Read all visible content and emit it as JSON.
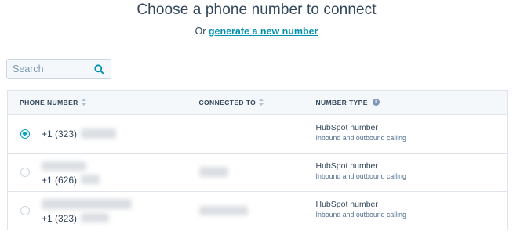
{
  "header": {
    "title": "Choose a phone number to connect",
    "prefix": "Or",
    "link_label": "generate a new number"
  },
  "search": {
    "placeholder": "Search",
    "icon": "search-icon"
  },
  "table": {
    "columns": [
      "PHONE NUMBER",
      "CONNECTED TO",
      "NUMBER TYPE"
    ],
    "rows": [
      {
        "selected": true,
        "phone": "+1 (323)",
        "type": "HubSpot number",
        "desc": "Inbound and outbound calling"
      },
      {
        "selected": false,
        "phone": "+1 (626)",
        "type": "HubSpot number",
        "desc": "Inbound and outbound calling"
      },
      {
        "selected": false,
        "phone": "+1 (323)",
        "type": "HubSpot number",
        "desc": "Inbound and outbound calling"
      }
    ]
  },
  "colors": {
    "accent": "#00a4bd",
    "link": "#0091ae",
    "text": "#33475b",
    "border": "#dfe3eb",
    "header_bg": "#f5f8fa"
  }
}
